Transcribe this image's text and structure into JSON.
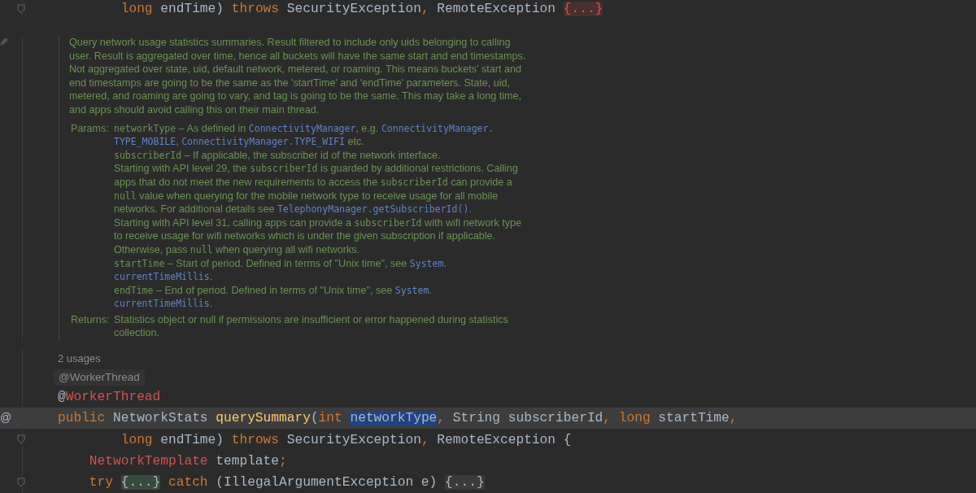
{
  "code_top": {
    "foldable": true,
    "tokens": [
      {
        "kind": "keyword",
        "text": "        long"
      },
      {
        "kind": "plain",
        "text": " endTime) "
      },
      {
        "kind": "keyword",
        "text": "throws"
      },
      {
        "kind": "plain",
        "text": " SecurityException"
      },
      {
        "kind": "keyword",
        "text": ","
      },
      {
        "kind": "plain",
        "text": " RemoteException "
      },
      {
        "kind": "folded-error",
        "text": "{...}"
      }
    ]
  },
  "doc": {
    "summary": [
      [
        {
          "kind": "text",
          "text": "Query network usage statistics summaries. Result filtered to include only uids belonging to calling"
        }
      ],
      [
        {
          "kind": "text",
          "text": "user. Result is aggregated over time, hence all buckets will have the same start and end timestamps."
        }
      ],
      [
        {
          "kind": "text",
          "text": "Not aggregated over state, uid, default network, metered, or roaming. This means buckets' start and"
        }
      ],
      [
        {
          "kind": "text",
          "text": "end timestamps are going to be the same as the 'startTime' and 'endTime' parameters. State, uid,"
        }
      ],
      [
        {
          "kind": "text",
          "text": "metered, and roaming are going to vary, and tag is going to be the same. This may take a long time,"
        }
      ],
      [
        {
          "kind": "text",
          "text": "and apps should avoid calling this on their main thread."
        }
      ]
    ],
    "sections": [
      {
        "label": "Params:",
        "lines": [
          [
            {
              "kind": "code",
              "text": "networkType"
            },
            {
              "kind": "text",
              "text": " – As defined in "
            },
            {
              "kind": "link",
              "text": "ConnectivityManager"
            },
            {
              "kind": "text",
              "text": ", e.g. "
            },
            {
              "kind": "link",
              "text": "ConnectivityManager."
            }
          ],
          [
            {
              "kind": "link",
              "text": "TYPE_MOBILE"
            },
            {
              "kind": "text",
              "text": ", "
            },
            {
              "kind": "link",
              "text": "ConnectivityManager.TYPE_WIFI"
            },
            {
              "kind": "text",
              "text": " etc."
            }
          ],
          [
            {
              "kind": "code",
              "text": "subscriberId"
            },
            {
              "kind": "text",
              "text": " – If applicable, the subscriber id of the network interface."
            }
          ],
          [
            {
              "kind": "text",
              "text": "Starting with API level 29, the "
            },
            {
              "kind": "code",
              "text": "subscriberId"
            },
            {
              "kind": "text",
              "text": " is guarded by additional restrictions. Calling"
            }
          ],
          [
            {
              "kind": "text",
              "text": "apps that do not meet the new requirements to access the "
            },
            {
              "kind": "code",
              "text": "subscriberId"
            },
            {
              "kind": "text",
              "text": " can provide a"
            }
          ],
          [
            {
              "kind": "code",
              "text": "null"
            },
            {
              "kind": "text",
              "text": " value when querying for the mobile network type to receive usage for all mobile"
            }
          ],
          [
            {
              "kind": "text",
              "text": "networks. For additional details see "
            },
            {
              "kind": "link",
              "text": "TelephonyManager.getSubscriberId()"
            },
            {
              "kind": "text",
              "text": "."
            }
          ],
          [
            {
              "kind": "text",
              "text": "Starting with API level 31, calling apps can provide a "
            },
            {
              "kind": "code",
              "text": "subscriberId"
            },
            {
              "kind": "text",
              "text": " with wifi network type"
            }
          ],
          [
            {
              "kind": "text",
              "text": "to receive usage for wifi networks which is under the given subscription if applicable."
            }
          ],
          [
            {
              "kind": "text",
              "text": "Otherwise, pass "
            },
            {
              "kind": "code",
              "text": "null"
            },
            {
              "kind": "text",
              "text": " when querying all wifi networks."
            }
          ],
          [
            {
              "kind": "code",
              "text": "startTime"
            },
            {
              "kind": "text",
              "text": " – Start of period. Defined in terms of \"Unix time\", see "
            },
            {
              "kind": "link",
              "text": "System"
            },
            {
              "kind": "text",
              "text": "."
            }
          ],
          [
            {
              "kind": "link",
              "text": "currentTimeMillis"
            },
            {
              "kind": "text",
              "text": "."
            }
          ],
          [
            {
              "kind": "code",
              "text": "endTime"
            },
            {
              "kind": "text",
              "text": " – End of period. Defined in terms of \"Unix time\", see "
            },
            {
              "kind": "link",
              "text": "System"
            },
            {
              "kind": "text",
              "text": "."
            }
          ],
          [
            {
              "kind": "link",
              "text": "currentTimeMillis"
            },
            {
              "kind": "text",
              "text": "."
            }
          ]
        ]
      },
      {
        "label": "Returns:",
        "lines": [
          [
            {
              "kind": "text",
              "text": "Statistics object or null if permissions are insufficient or error happened during statistics"
            }
          ],
          [
            {
              "kind": "text",
              "text": "collection."
            }
          ]
        ]
      }
    ]
  },
  "usages": "2 usages",
  "inlay_hint": "@WorkerThread",
  "code": [
    {
      "foldable": false,
      "current": false,
      "tokens": [
        {
          "kind": "plain",
          "text": "@"
        },
        {
          "kind": "annotation",
          "text": "WorkerThread"
        }
      ]
    },
    {
      "foldable": false,
      "gutter_text": "@",
      "current": true,
      "tokens": [
        {
          "kind": "keyword",
          "text": "public"
        },
        {
          "kind": "plain",
          "text": " NetworkStats "
        },
        {
          "kind": "method",
          "text": "querySummary"
        },
        {
          "kind": "plain",
          "text": "("
        },
        {
          "kind": "keyword",
          "text": "int "
        },
        {
          "kind": "selected",
          "text": "networkType"
        },
        {
          "kind": "keyword",
          "text": ","
        },
        {
          "kind": "plain",
          "text": " String subscriberId"
        },
        {
          "kind": "keyword",
          "text": ", long"
        },
        {
          "kind": "plain",
          "text": " startTime"
        },
        {
          "kind": "keyword",
          "text": ","
        }
      ]
    },
    {
      "foldable": true,
      "current": false,
      "tokens": [
        {
          "kind": "keyword",
          "text": "        long"
        },
        {
          "kind": "plain",
          "text": " endTime) "
        },
        {
          "kind": "keyword",
          "text": "throws"
        },
        {
          "kind": "plain",
          "text": " SecurityException"
        },
        {
          "kind": "keyword",
          "text": ","
        },
        {
          "kind": "plain",
          "text": " RemoteException {"
        }
      ]
    },
    {
      "foldable": false,
      "current": false,
      "tokens": [
        {
          "kind": "error",
          "text": "    NetworkTemplate"
        },
        {
          "kind": "plain",
          "text": " template"
        },
        {
          "kind": "keyword",
          "text": ";"
        }
      ]
    },
    {
      "foldable": true,
      "current": false,
      "tokens": [
        {
          "kind": "keyword",
          "text": "    try "
        },
        {
          "kind": "folded",
          "text": "{...}"
        },
        {
          "kind": "keyword",
          "text": " catch"
        },
        {
          "kind": "plain",
          "text": " (IllegalArgumentException e) "
        },
        {
          "kind": "folded-plain",
          "text": "{...}"
        }
      ]
    }
  ]
}
